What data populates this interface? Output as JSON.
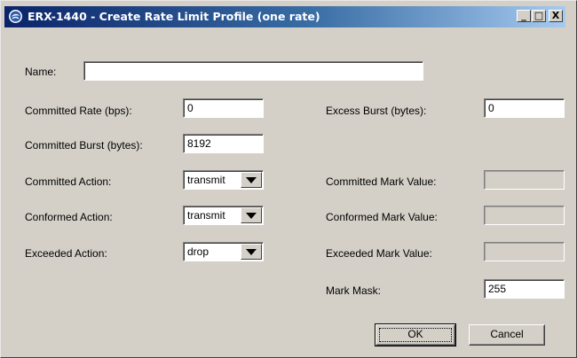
{
  "window": {
    "title": "ERX-1440 - Create Rate Limit Profile (one rate)",
    "minimize_glyph": "_",
    "maximize_glyph": "□",
    "close_glyph": "X"
  },
  "form": {
    "name_label": "Name:",
    "name_value": "",
    "committed_rate_label": "Committed Rate (bps):",
    "committed_rate_value": "0",
    "excess_burst_label": "Excess Burst (bytes):",
    "excess_burst_value": "0",
    "committed_burst_label": "Committed Burst (bytes):",
    "committed_burst_value": "8192",
    "committed_action_label": "Committed Action:",
    "committed_action_value": "transmit",
    "committed_mark_label": "Committed Mark Value:",
    "committed_mark_value": "",
    "conformed_action_label": "Conformed Action:",
    "conformed_action_value": "transmit",
    "conformed_mark_label": "Conformed Mark Value:",
    "conformed_mark_value": "",
    "exceeded_action_label": "Exceeded Action:",
    "exceeded_action_value": "drop",
    "exceeded_mark_label": "Exceeded Mark Value:",
    "exceeded_mark_value": "",
    "mark_mask_label": "Mark Mask:",
    "mark_mask_value": "255"
  },
  "buttons": {
    "ok": "OK",
    "cancel": "Cancel"
  },
  "colors": {
    "title_start": "#0a246a",
    "title_end": "#a6caf0",
    "dialog_bg": "#d4d0c8"
  },
  "icons": {
    "title": "juniper-app-icon",
    "dropdown": "dropdown-arrow-icon"
  }
}
